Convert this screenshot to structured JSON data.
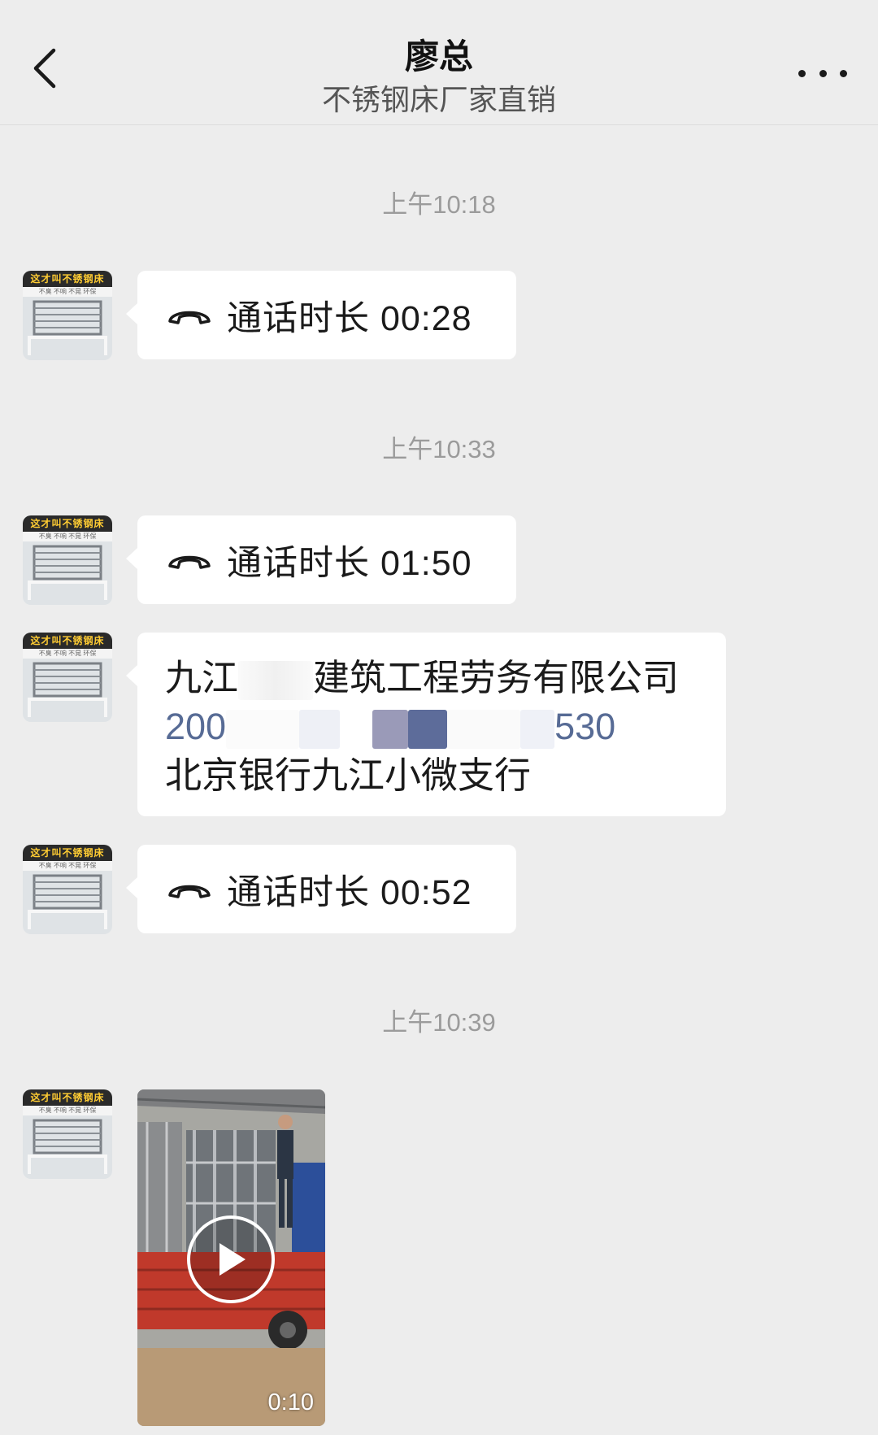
{
  "header": {
    "title": "廖总",
    "subtitle": "不锈钢床厂家直销",
    "back_icon": "chevron-left-icon",
    "more_icon": "more-dots-icon"
  },
  "avatar": {
    "banner": "这才叫不锈钢床",
    "banner_sub": "不臭 不响 不晃 环保"
  },
  "messages": [
    {
      "type": "timestamp",
      "text": "上午10:18"
    },
    {
      "type": "call",
      "icon": "phone-hangup-icon",
      "text": "通话时长 00:28"
    },
    {
      "type": "timestamp",
      "text": "上午10:33"
    },
    {
      "type": "call",
      "icon": "phone-hangup-icon",
      "text": "通话时长 01:50"
    },
    {
      "type": "text",
      "line1_start": "九江",
      "line1_end": "建筑工程劳务有限公司",
      "line2_start": "200",
      "line2_end": "530",
      "line3": "北京银行九江小微支行"
    },
    {
      "type": "call",
      "icon": "phone-hangup-icon",
      "text": "通话时长 00:52"
    },
    {
      "type": "timestamp",
      "text": "上午10:39"
    },
    {
      "type": "video",
      "icon": "play-icon",
      "duration": "0:10"
    }
  ],
  "colors": {
    "background": "#ededed",
    "bubble": "#ffffff",
    "timestamp": "#9b9b9b",
    "link": "#576b95"
  }
}
